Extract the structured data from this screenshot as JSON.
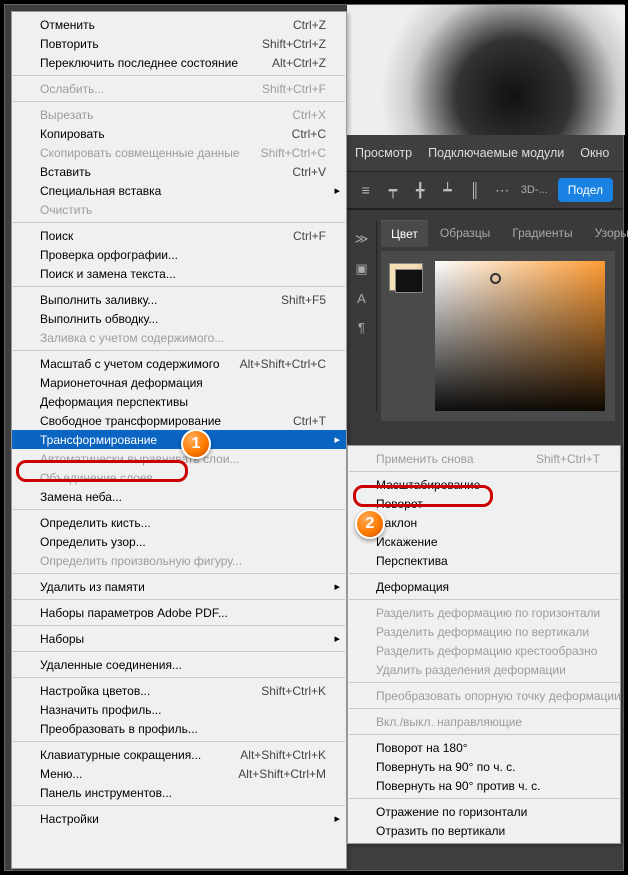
{
  "menubar": {
    "viewLabel": "Просмотр",
    "pluginsLabel": "Подключаемые модули",
    "windowLabel": "Окно"
  },
  "toolbar": {
    "threeD": "3D-...",
    "share": "Подел"
  },
  "panel": {
    "tabs": {
      "color": "Цвет",
      "swatches": "Образцы",
      "gradients": "Градиенты",
      "patterns": "Узоры"
    }
  },
  "mainMenu": [
    [
      {
        "label": "Отменить",
        "shortcut": "Ctrl+Z",
        "enabled": true
      },
      {
        "label": "Повторить",
        "shortcut": "Shift+Ctrl+Z",
        "enabled": true
      },
      {
        "label": "Переключить последнее состояние",
        "shortcut": "Alt+Ctrl+Z",
        "enabled": true
      }
    ],
    [
      {
        "label": "Ослабить...",
        "shortcut": "Shift+Ctrl+F",
        "enabled": false
      }
    ],
    [
      {
        "label": "Вырезать",
        "shortcut": "Ctrl+X",
        "enabled": false
      },
      {
        "label": "Копировать",
        "shortcut": "Ctrl+C",
        "enabled": true
      },
      {
        "label": "Скопировать совмещенные данные",
        "shortcut": "Shift+Ctrl+C",
        "enabled": false
      },
      {
        "label": "Вставить",
        "shortcut": "Ctrl+V",
        "enabled": true
      },
      {
        "label": "Специальная вставка",
        "shortcut": "",
        "enabled": true,
        "sub": true
      },
      {
        "label": "Очистить",
        "shortcut": "",
        "enabled": false
      }
    ],
    [
      {
        "label": "Поиск",
        "shortcut": "Ctrl+F",
        "enabled": true
      },
      {
        "label": "Проверка орфографии...",
        "shortcut": "",
        "enabled": true
      },
      {
        "label": "Поиск и замена текста...",
        "shortcut": "",
        "enabled": true
      }
    ],
    [
      {
        "label": "Выполнить заливку...",
        "shortcut": "Shift+F5",
        "enabled": true
      },
      {
        "label": "Выполнить обводку...",
        "shortcut": "",
        "enabled": true
      },
      {
        "label": "Заливка с учетом содержимого...",
        "shortcut": "",
        "enabled": false
      }
    ],
    [
      {
        "label": "Масштаб с учетом содержимого",
        "shortcut": "Alt+Shift+Ctrl+C",
        "enabled": true
      },
      {
        "label": "Марионеточная деформация",
        "shortcut": "",
        "enabled": true
      },
      {
        "label": "Деформация перспективы",
        "shortcut": "",
        "enabled": true
      },
      {
        "label": "Свободное трансформирование",
        "shortcut": "Ctrl+T",
        "enabled": true
      },
      {
        "label": "Трансформирование",
        "shortcut": "",
        "enabled": true,
        "sub": true,
        "highlighted": true
      },
      {
        "label": "Автоматически выравнивать слои...",
        "shortcut": "",
        "enabled": false
      },
      {
        "label": "Объединение слоев...",
        "shortcut": "",
        "enabled": false
      },
      {
        "label": "Замена неба...",
        "shortcut": "",
        "enabled": true
      }
    ],
    [
      {
        "label": "Определить кисть...",
        "shortcut": "",
        "enabled": true
      },
      {
        "label": "Определить узор...",
        "shortcut": "",
        "enabled": true
      },
      {
        "label": "Определить произвольную фигуру...",
        "shortcut": "",
        "enabled": false
      }
    ],
    [
      {
        "label": "Удалить из памяти",
        "shortcut": "",
        "enabled": true,
        "sub": true
      }
    ],
    [
      {
        "label": "Наборы параметров Adobe PDF...",
        "shortcut": "",
        "enabled": true
      }
    ],
    [
      {
        "label": "Наборы",
        "shortcut": "",
        "enabled": true,
        "sub": true
      }
    ],
    [
      {
        "label": "Удаленные соединения...",
        "shortcut": "",
        "enabled": true
      }
    ],
    [
      {
        "label": "Настройка цветов...",
        "shortcut": "Shift+Ctrl+K",
        "enabled": true
      },
      {
        "label": "Назначить профиль...",
        "shortcut": "",
        "enabled": true
      },
      {
        "label": "Преобразовать в профиль...",
        "shortcut": "",
        "enabled": true
      }
    ],
    [
      {
        "label": "Клавиатурные сокращения...",
        "shortcut": "Alt+Shift+Ctrl+K",
        "enabled": true
      },
      {
        "label": "Меню...",
        "shortcut": "Alt+Shift+Ctrl+M",
        "enabled": true
      },
      {
        "label": "Панель инструментов...",
        "shortcut": "",
        "enabled": true
      }
    ],
    [
      {
        "label": "Настройки",
        "shortcut": "",
        "enabled": true,
        "sub": true
      }
    ]
  ],
  "subMenu": [
    [
      {
        "label": "Применить снова",
        "shortcut": "Shift+Ctrl+T",
        "enabled": false
      }
    ],
    [
      {
        "label": "Масштабирование",
        "shortcut": "",
        "enabled": true,
        "ringed": true
      },
      {
        "label": "Поворот",
        "shortcut": "",
        "enabled": true
      },
      {
        "label": "Наклон",
        "shortcut": "",
        "enabled": true
      },
      {
        "label": "Искажение",
        "shortcut": "",
        "enabled": true
      },
      {
        "label": "Перспектива",
        "shortcut": "",
        "enabled": true
      }
    ],
    [
      {
        "label": "Деформация",
        "shortcut": "",
        "enabled": true
      }
    ],
    [
      {
        "label": "Разделить деформацию по горизонтали",
        "shortcut": "",
        "enabled": false
      },
      {
        "label": "Разделить деформацию по вертикали",
        "shortcut": "",
        "enabled": false
      },
      {
        "label": "Разделить деформацию крестообразно",
        "shortcut": "",
        "enabled": false
      },
      {
        "label": "Удалить разделения деформации",
        "shortcut": "",
        "enabled": false
      }
    ],
    [
      {
        "label": "Преобразовать опорную точку деформации",
        "shortcut": "",
        "enabled": false
      }
    ],
    [
      {
        "label": "Вкл./выкл. направляющие",
        "shortcut": "",
        "enabled": false
      }
    ],
    [
      {
        "label": "Поворот на 180°",
        "shortcut": "",
        "enabled": true
      },
      {
        "label": "Повернуть на 90° по ч. с.",
        "shortcut": "",
        "enabled": true
      },
      {
        "label": "Повернуть на 90° против ч. с.",
        "shortcut": "",
        "enabled": true
      }
    ],
    [
      {
        "label": "Отражение по горизонтали",
        "shortcut": "",
        "enabled": true
      },
      {
        "label": "Отразить по вертикали",
        "shortcut": "",
        "enabled": true
      }
    ]
  ],
  "callouts": {
    "one": "1",
    "two": "2"
  }
}
